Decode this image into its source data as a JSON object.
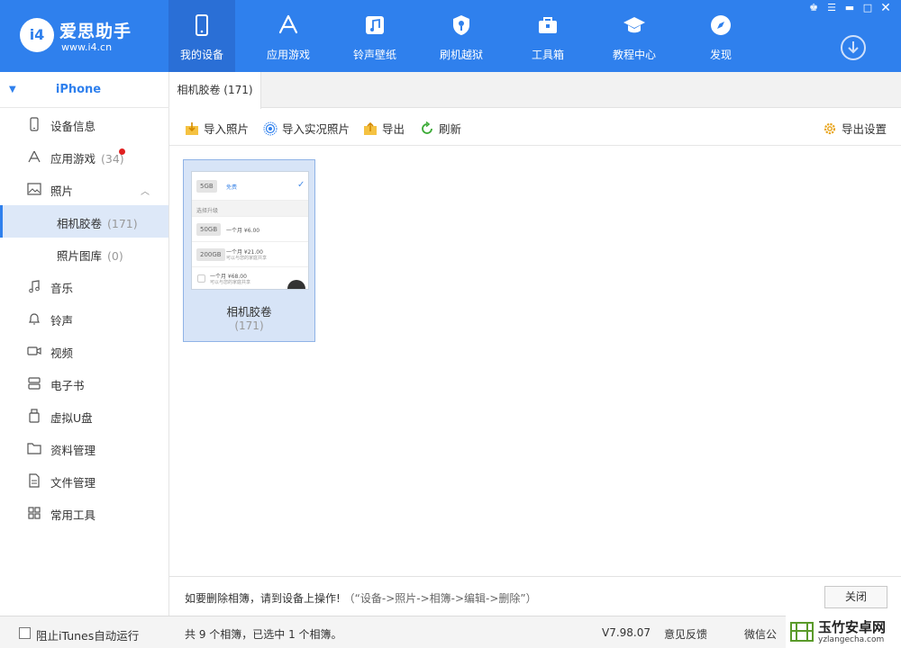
{
  "app": {
    "logo_mark": "i4",
    "logo_name": "爱思助手",
    "logo_url": "www.i4.cn"
  },
  "nav": [
    {
      "label": "我的设备",
      "icon": "phone-icon",
      "active": true
    },
    {
      "label": "应用游戏",
      "icon": "app-store-icon"
    },
    {
      "label": "铃声壁纸",
      "icon": "music-note-icon"
    },
    {
      "label": "刷机越狱",
      "icon": "key-shield-icon"
    },
    {
      "label": "工具箱",
      "icon": "toolbox-icon"
    },
    {
      "label": "教程中心",
      "icon": "graduation-cap-icon"
    },
    {
      "label": "发现",
      "icon": "compass-icon"
    }
  ],
  "window_controls": [
    "shirt-icon",
    "menu-icon",
    "minimize-icon",
    "maximize-icon",
    "close-icon"
  ],
  "sidebar": {
    "device_name": "iPhone",
    "items": [
      {
        "label": "设备信息",
        "icon": "device-info-icon"
      },
      {
        "label": "应用游戏",
        "count": "(34)",
        "icon": "apps-icon",
        "badge": true
      },
      {
        "label": "照片",
        "icon": "photo-icon",
        "expanded": true
      },
      {
        "label": "相机胶卷",
        "count": "(171)",
        "sub": true,
        "selected": true
      },
      {
        "label": "照片图库",
        "count": "(0)",
        "sub": true
      },
      {
        "label": "音乐",
        "icon": "music-icon"
      },
      {
        "label": "铃声",
        "icon": "bell-icon"
      },
      {
        "label": "视频",
        "icon": "video-icon"
      },
      {
        "label": "电子书",
        "icon": "ebook-icon"
      },
      {
        "label": "虚拟U盘",
        "icon": "usb-drive-icon"
      },
      {
        "label": "资料管理",
        "icon": "folder-icon"
      },
      {
        "label": "文件管理",
        "icon": "file-icon"
      },
      {
        "label": "常用工具",
        "icon": "grid-icon"
      }
    ]
  },
  "tab": {
    "label": "相机胶卷 (171)"
  },
  "toolbar": {
    "import_photos": "导入照片",
    "import_live": "导入实况照片",
    "export": "导出",
    "refresh": "刷新",
    "export_settings": "导出设置"
  },
  "album": {
    "name": "相机胶卷",
    "count": "(171)",
    "thumb": {
      "row1_size": "5GB",
      "row1_text": "免费",
      "section": "选择升级",
      "row2_size": "50GB",
      "row2_text": "一个月 ¥6.00",
      "row3_size": "200GB",
      "row3_text": "一个月 ¥21.00",
      "row3_sub": "可以与您的家庭共享",
      "row4_text": "一个月 ¥68.00",
      "row4_sub": "可以与您的家庭共享"
    }
  },
  "notice": {
    "text": "如要删除相簿，请到设备上操作!",
    "hint": "（“设备->照片->相簿->编辑->删除”）",
    "close_label": "关闭"
  },
  "statusbar": {
    "itunes_label": "阻止iTunes自动运行",
    "summary": "共 9 个相簿，已选中 1 个相簿。",
    "version": "V7.98.07",
    "feedback": "意见反馈",
    "wechat": "微信公"
  },
  "watermark": {
    "title": "玉竹安卓网",
    "url": "yzlangecha.com"
  },
  "colors": {
    "brand_blue": "#2f80ed",
    "active_nav": "#2a6fd6",
    "selected_bg": "#dde8f8",
    "badge_red": "#e02020"
  }
}
